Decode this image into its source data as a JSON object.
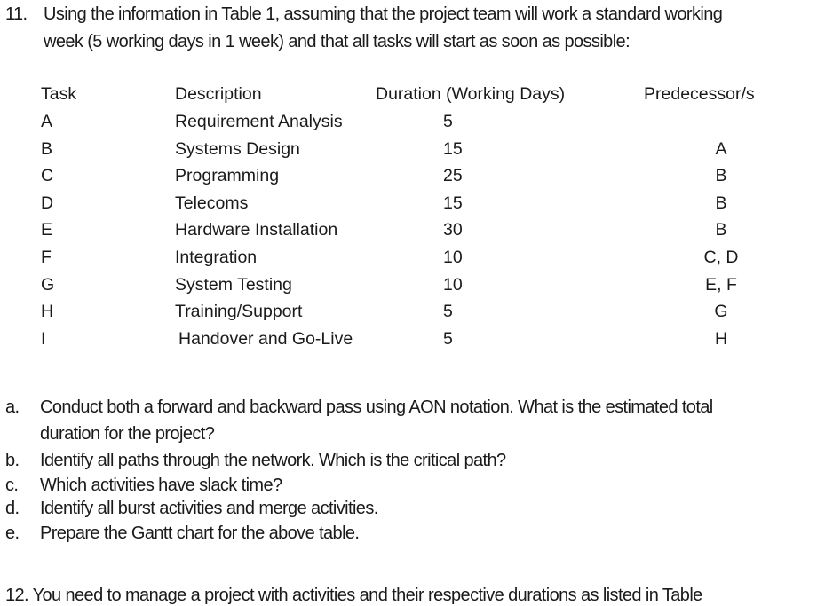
{
  "question": {
    "number": "11.",
    "line1": "Using the information in Table 1, assuming that the project team will work a standard working",
    "line2": "week (5 working days in 1 week) and that all tasks will start as soon as possible:"
  },
  "table": {
    "headers": {
      "task": "Task",
      "description": "Description",
      "duration": "Duration (Working Days)",
      "predecessors": "Predecessor/s"
    },
    "rows": [
      {
        "task": "A",
        "description": "Requirement Analysis",
        "duration": "5",
        "predecessors": ""
      },
      {
        "task": "B",
        "description": "Systems Design",
        "duration": "15",
        "predecessors": "A"
      },
      {
        "task": "C",
        "description": "Programming",
        "duration": "25",
        "predecessors": "B"
      },
      {
        "task": "D",
        "description": "Telecoms",
        "duration": "15",
        "predecessors": "B"
      },
      {
        "task": "E",
        "description": "Hardware Installation",
        "duration": "30",
        "predecessors": "B"
      },
      {
        "task": "F",
        "description": "Integration",
        "duration": "10",
        "predecessors": "C, D"
      },
      {
        "task": "G",
        "description": "System Testing",
        "duration": "10",
        "predecessors": "E, F"
      },
      {
        "task": "H",
        "description": "Training/Support",
        "duration": "5",
        "predecessors": "G"
      },
      {
        "task": "I",
        "description": "Handover and Go-Live",
        "duration": "5",
        "predecessors": "H"
      }
    ]
  },
  "subquestions": [
    {
      "label": "a.",
      "lines": [
        "Conduct both a forward and backward pass using AON notation.  What is the estimated total",
        "duration for the project?"
      ]
    },
    {
      "label": "b.",
      "lines": [
        "Identify all paths through the network.  Which is the critical path?"
      ]
    },
    {
      "label": "c.",
      "lines": [
        "Which activities have slack time?"
      ]
    },
    {
      "label": "d.",
      "lines": [
        "Identify all burst activities and merge activities."
      ]
    },
    {
      "label": "e.",
      "lines": [
        "Prepare the Gantt chart for the above table."
      ]
    }
  ],
  "next_question_partial": "12.  You need to manage a project with activities and their respective durations as listed in Table"
}
